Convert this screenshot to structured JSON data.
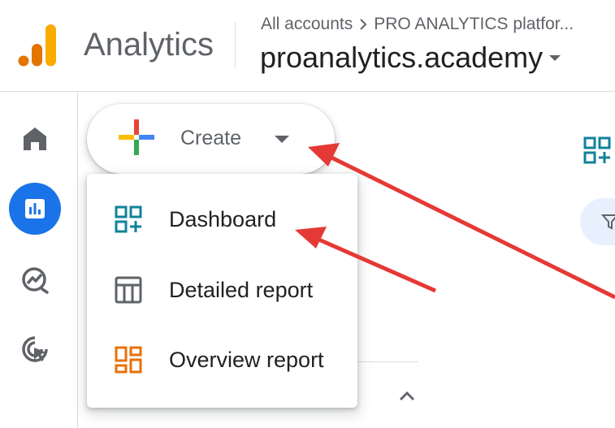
{
  "header": {
    "app_name": "Analytics",
    "breadcrumb": {
      "root": "All accounts",
      "account": "PRO ANALYTICS platfor..."
    },
    "property_name": "proanalytics.academy"
  },
  "rail": {
    "items": [
      {
        "icon": "home-icon"
      },
      {
        "icon": "reports-icon"
      },
      {
        "icon": "explore-icon"
      },
      {
        "icon": "advertising-icon"
      }
    ]
  },
  "create": {
    "label": "Create"
  },
  "menu": {
    "items": [
      {
        "label": "Dashboard",
        "icon": "dashboard-add-icon"
      },
      {
        "label": "Detailed report",
        "icon": "table-report-icon"
      },
      {
        "label": "Overview report",
        "icon": "overview-report-icon"
      }
    ]
  },
  "colors": {
    "brand_blue": "#1a73e8",
    "logo_orange": "#f9ab00",
    "logo_dark_orange": "#e37400",
    "menu_icon_teal": "#12829b",
    "overview_icon_orange": "#e8710a",
    "annotation_red": "#e53935"
  }
}
